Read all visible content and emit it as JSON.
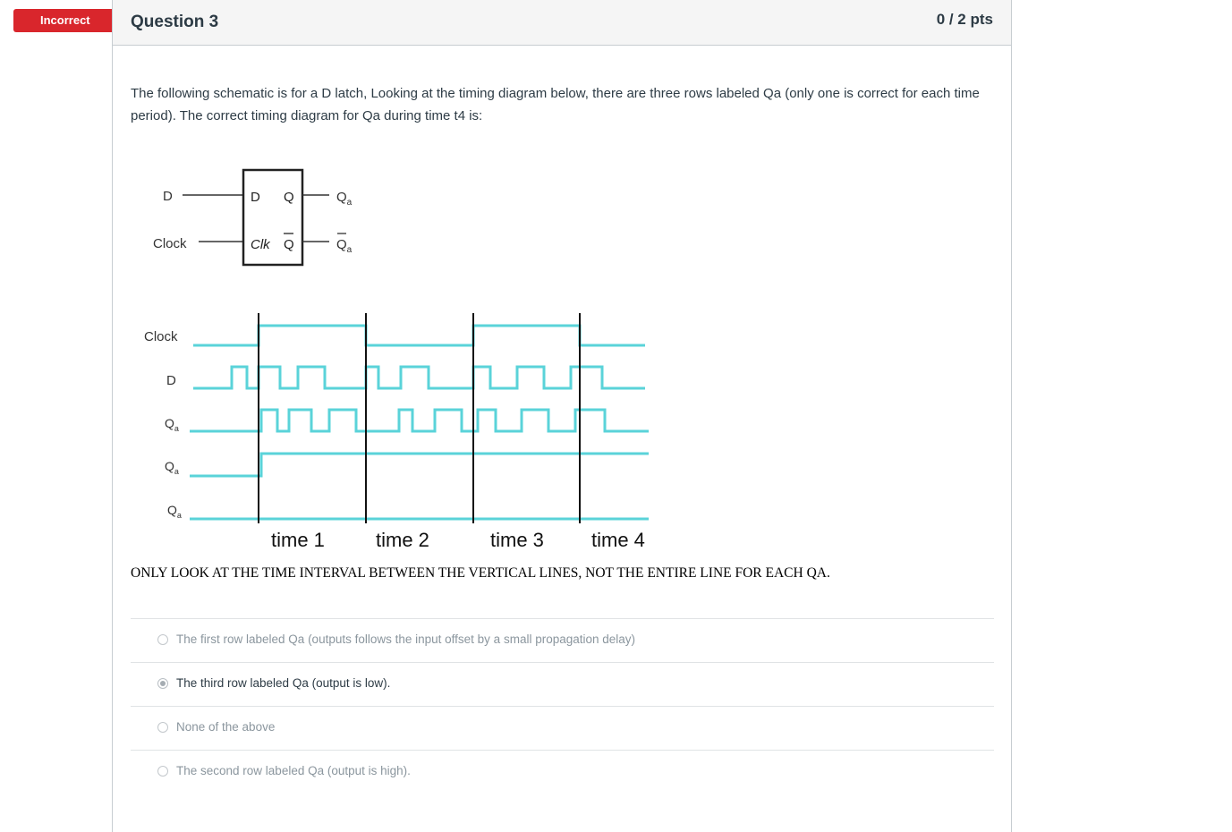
{
  "status_badge": "Incorrect",
  "question": {
    "title": "Question 3",
    "points": "0 / 2 pts",
    "text": "The following schematic is for a D latch, Looking at the timing diagram below, there are three rows labeled Qa (only one is correct for each time period). The correct timing diagram for Qa during time t4 is:",
    "note": "ONLY LOOK AT THE TIME INTERVAL BETWEEN THE VERTICAL LINES, NOT THE ENTIRE LINE FOR EACH QA."
  },
  "schematic": {
    "input_d": "D",
    "input_clock": "Clock",
    "box_d": "D",
    "box_q": "Q",
    "box_clk": "Clk",
    "box_qbar": "Q",
    "out_q": "Q",
    "out_q_sub": "a",
    "out_qbar": "Q",
    "out_qbar_sub": "a"
  },
  "timing": {
    "row_labels": [
      "Clock",
      "D"
    ],
    "qa_label": "Q",
    "qa_sub": "a",
    "time_labels": [
      "time 1",
      "time 2",
      "time 3",
      "time 4"
    ],
    "line_color": "#5ad3d9"
  },
  "answers": [
    {
      "label": "The first row labeled Qa  (outputs follows the input offset by a small propagation delay)",
      "selected": false
    },
    {
      "label": "The third row labeled Qa (output is low).",
      "selected": true
    },
    {
      "label": "None of the above",
      "selected": false
    },
    {
      "label": "The second row labeled Qa  (output is high).",
      "selected": false
    }
  ]
}
